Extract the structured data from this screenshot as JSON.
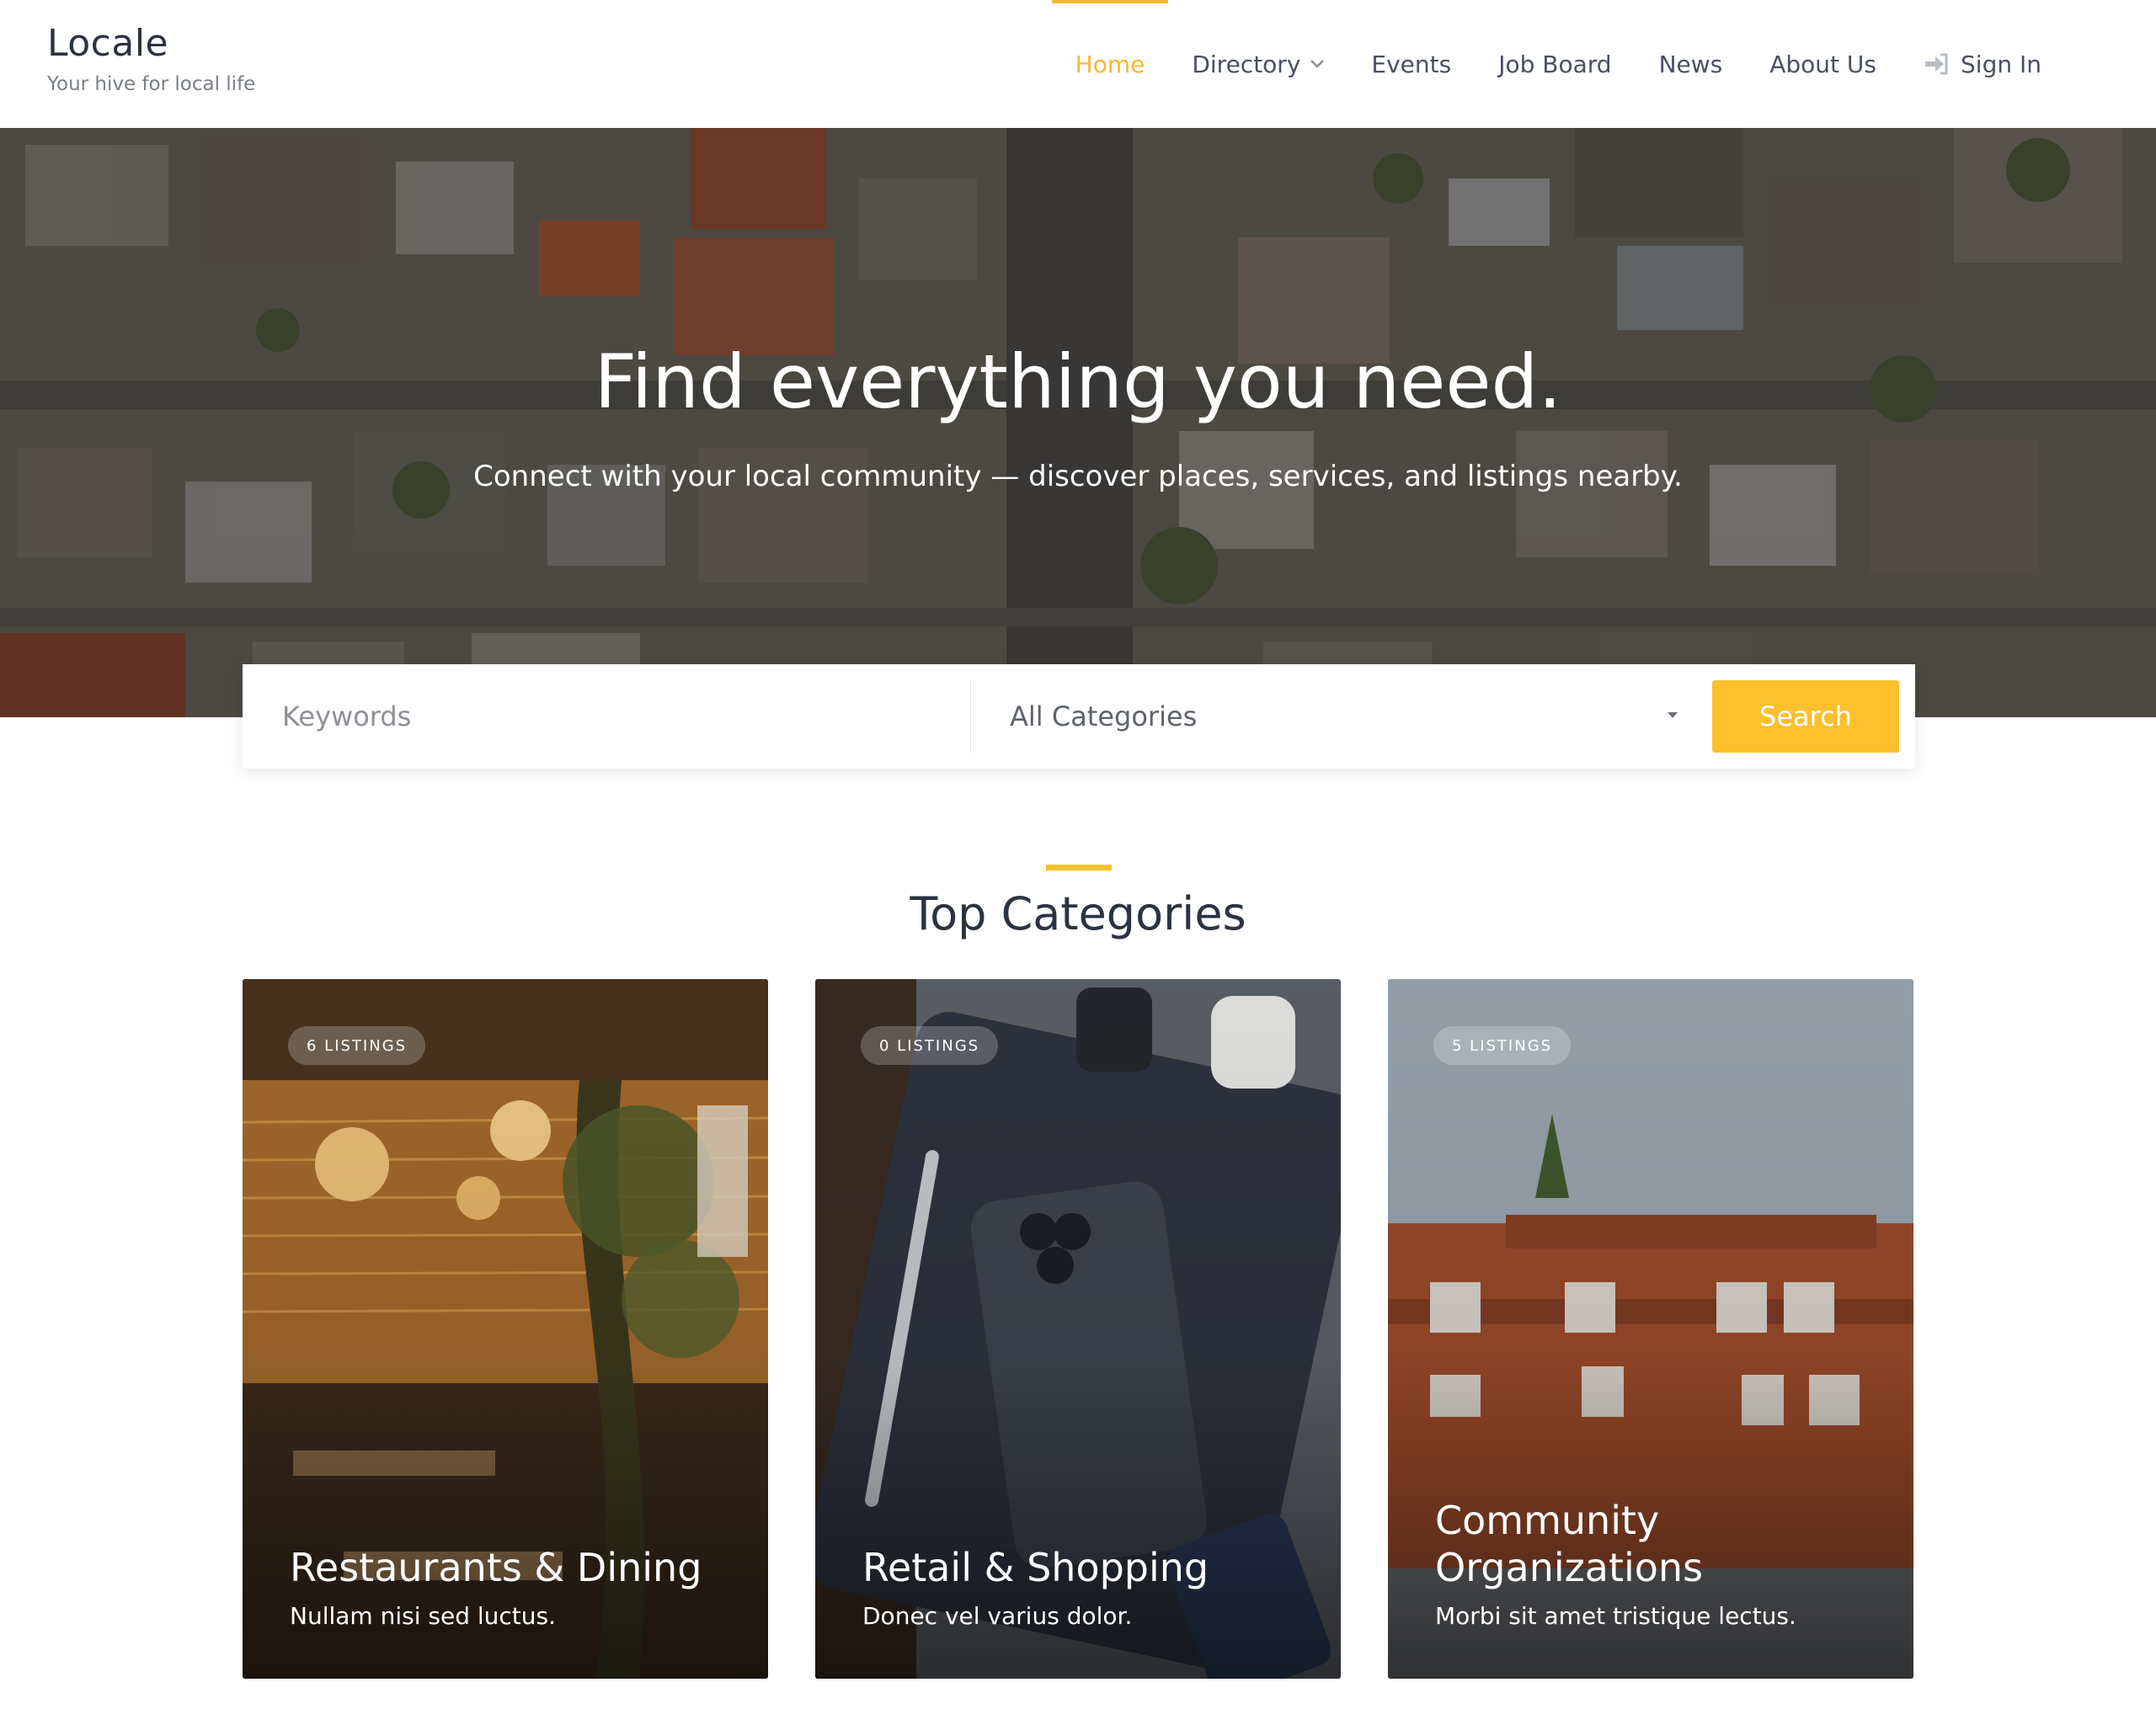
{
  "brand": {
    "title": "Locale",
    "tagline": "Your hive for local life"
  },
  "nav": {
    "items": [
      {
        "label": "Home",
        "active": true
      },
      {
        "label": "Directory",
        "has_dropdown": true
      },
      {
        "label": "Events"
      },
      {
        "label": "Job Board"
      },
      {
        "label": "News"
      },
      {
        "label": "About Us"
      }
    ],
    "signin_label": "Sign In"
  },
  "hero": {
    "title": "Find everything you need.",
    "subtitle": "Connect with your local community — discover places, services, and listings nearby."
  },
  "search": {
    "keywords_placeholder": "Keywords",
    "keywords_value": "",
    "category_selected": "All Categories",
    "button_label": "Search"
  },
  "categories": {
    "heading": "Top Categories",
    "items": [
      {
        "count_label": "6 LISTINGS",
        "title": "Restaurants & Dining",
        "description": "Nullam nisi sed luctus."
      },
      {
        "count_label": "0 LISTINGS",
        "title": "Retail & Shopping",
        "description": "Donec vel varius dolor."
      },
      {
        "count_label": "5 LISTINGS",
        "title": "Community Organizations",
        "description": "Morbi sit amet tristique lectus."
      }
    ]
  },
  "colors": {
    "accent": "#fbc02d",
    "nav_active": "#f7b731",
    "heading": "#2c3340"
  },
  "icons": [
    "chevron-down-icon",
    "sign-in-icon",
    "select-caret-icon"
  ]
}
